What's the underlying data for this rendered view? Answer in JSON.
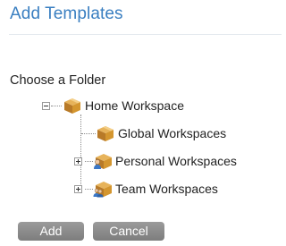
{
  "dialog": {
    "title": "Add Templates",
    "folder_label": "Choose a Folder"
  },
  "tree": {
    "root": {
      "label": "Home Workspace",
      "expanded": true,
      "icon": "box-icon"
    },
    "children": [
      {
        "label": "Global Workspaces",
        "expandable": false,
        "icon": "box-icon"
      },
      {
        "label": "Personal Workspaces",
        "expandable": true,
        "icon": "person-box-icon"
      },
      {
        "label": "Team Workspaces",
        "expandable": true,
        "icon": "team-box-icon"
      }
    ]
  },
  "buttons": {
    "add_label": "Add",
    "cancel_label": "Cancel"
  }
}
